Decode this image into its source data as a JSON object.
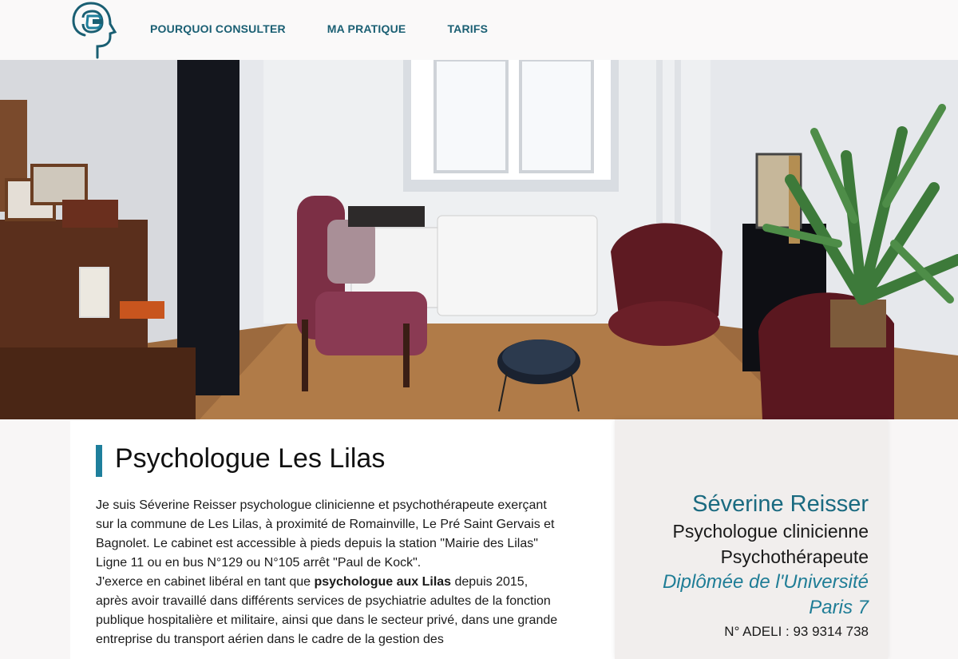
{
  "header": {
    "logo_icon": "head-profile-logo-icon",
    "nav": [
      {
        "label": "POURQUOI CONSULTER"
      },
      {
        "label": "MA PRATIQUE"
      },
      {
        "label": "TARIFS"
      }
    ]
  },
  "colors": {
    "accent": "#1e7f9c",
    "nav_text": "#1a5f73",
    "panel_bg": "#f1eeed"
  },
  "main": {
    "title": "Psychologue Les Lilas",
    "paragraph1": "Je suis Séverine Reisser psychologue clinicienne et psychothérapeute exerçant sur la commune de Les Lilas, à proximité de Romainville, Le Pré Saint Gervais et Bagnolet. Le cabinet est accessible à pieds depuis la station \"Mairie des Lilas\" Ligne 11 ou en bus N°129 ou N°105 arrêt \"Paul de Kock\".",
    "paragraph2_pre": "J'exerce en cabinet libéral en tant que ",
    "paragraph2_bold": "psychologue aux Lilas",
    "paragraph2_post": " depuis 2015, après avoir travaillé dans différents services de psychiatrie adultes de la fonction publique hospitalière et militaire, ainsi que dans le secteur privé, dans une grande entreprise du transport aérien dans le cadre de la gestion des"
  },
  "sidebar": {
    "name": "Séverine Reisser",
    "role1": "Psychologue clinicienne",
    "role2": "Psychothérapeute",
    "diploma1": "Diplômée de l'Université",
    "diploma2": "Paris 7",
    "adeli": "N° ADELI : 93 9314 738"
  }
}
